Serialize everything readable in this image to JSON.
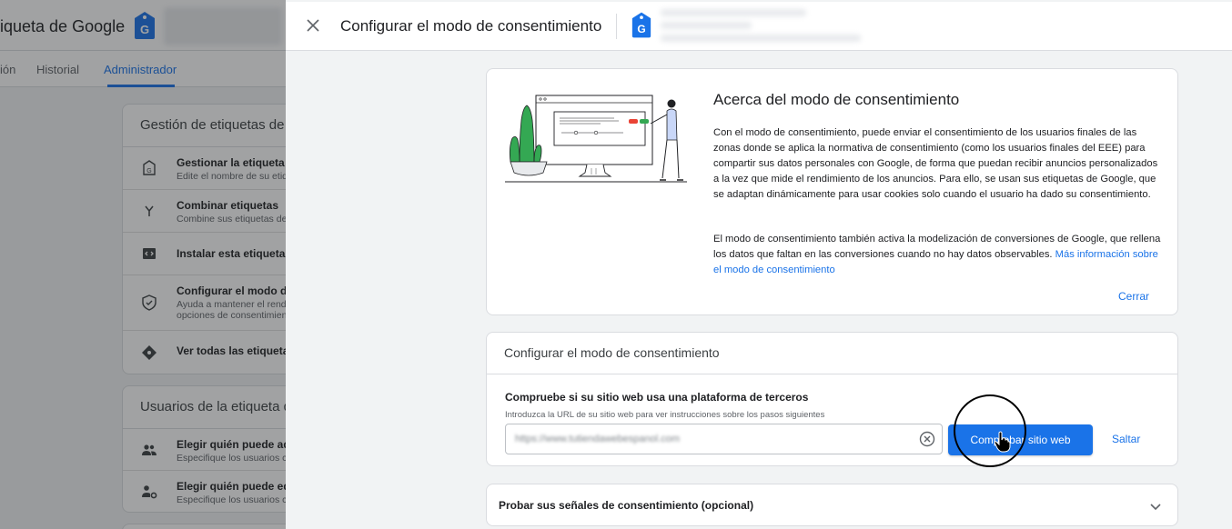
{
  "background_page": {
    "title": "iqueta de Google",
    "tabs": [
      {
        "label": "ión"
      },
      {
        "label": "Historial"
      },
      {
        "label": "Administrador"
      }
    ],
    "management_card": {
      "title": "Gestión de etiquetas de Go",
      "items": [
        {
          "title": "Gestionar la etiqueta d",
          "subtitle": "Edite el nombre de su etiq",
          "icon": "tag-icon"
        },
        {
          "title": "Combinar etiquetas",
          "subtitle": "Combine sus etiquetas de",
          "icon": "merge-icon"
        },
        {
          "title": "Instalar esta etiqueta c",
          "subtitle": "",
          "icon": "code-icon"
        },
        {
          "title": "Configurar el modo de",
          "subtitle": "Ayuda a mantener el rend",
          "subtitle2": "opciones de consentimien",
          "icon": "shield-check-icon"
        },
        {
          "title": "Ver todas las etiquetas",
          "subtitle": "",
          "icon": "tag-manager-icon"
        }
      ]
    },
    "users_card": {
      "title": "Usuarios de la etiqueta de",
      "items": [
        {
          "title": "Elegir quién puede adr",
          "subtitle": "Especifique los usuarios c",
          "icon": "users-icon"
        },
        {
          "title": "Elegir quién puede edit",
          "subtitle": "Especifique los usuarios c",
          "icon": "user-settings-icon"
        }
      ]
    }
  },
  "drawer": {
    "title": "Configurar el modo de consentimiento",
    "close_icon": "close-icon",
    "logo_icon": "google-tag-icon"
  },
  "about": {
    "title": "Acerca del modo de consentimiento",
    "paragraph1": "Con el modo de consentimiento, puede enviar el consentimiento de los usuarios finales de las zonas donde se aplica la normativa de consentimiento (como los usuarios finales del EEE) para compartir sus datos personales con Google, de forma que puedan recibir anuncios personalizados a la vez que mide el rendimiento de los anuncios. Para ello, se usan sus etiquetas de Google, que se adaptan dinámicamente para usar cookies solo cuando el usuario ha dado su consentimiento.",
    "paragraph2": "El modo de consentimiento también activa la modelización de conversiones de Google, que rellena los datos que faltan en las conversiones cuando no hay datos observables.",
    "more_link": "Más información sobre el modo de consentimiento",
    "close_label": "Cerrar"
  },
  "configure": {
    "title": "Configurar el modo de consentimiento",
    "check_label": "Compruebe si su sitio web usa una plataforma de terceros",
    "help_text": "Introduzca la URL de su sitio web para ver instrucciones sobre los pasos siguientes",
    "url_value": "https://www.tutiendawebespanol.com",
    "check_button": "Comprobar sitio web",
    "skip_button": "Saltar"
  },
  "test": {
    "title": "Probar sus señales de consentimiento (opcional)"
  },
  "colors": {
    "accent": "#1a73e8",
    "brand_tag": "#1a73e8",
    "overlay": "#202124"
  }
}
